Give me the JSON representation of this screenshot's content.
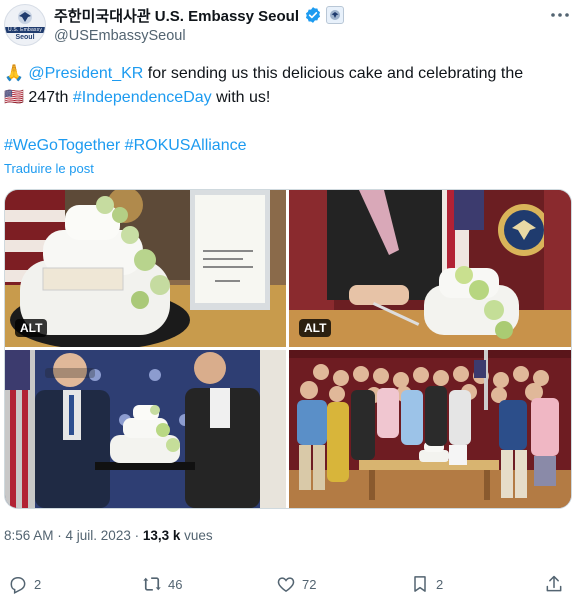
{
  "account": {
    "display_name": "주한미국대사관 U.S. Embassy Seoul",
    "handle": "@USEmbassySeoul",
    "avatar_text_top": "U.S. Embassy",
    "avatar_text_bottom": "Seoul"
  },
  "tweet": {
    "emoji_hands": "🙏",
    "mention": "@President_KR",
    "text_1": " for sending us this delicious cake and celebrating the",
    "emoji_flag": "🇺🇸",
    "text_2": " 247th ",
    "hashtag_day": "#IndependenceDay",
    "text_3": " with us!",
    "hashtag_1": "#WeGoTogether",
    "hashtag_2": "#ROKUSAlliance",
    "translate_label": "Traduire le post"
  },
  "media": {
    "alt_label": "ALT",
    "photos": [
      {
        "name": "cake-and-letter",
        "has_alt": true
      },
      {
        "name": "cake-cutting",
        "has_alt": true
      },
      {
        "name": "cake-handover",
        "has_alt": false
      },
      {
        "name": "group-photo",
        "has_alt": false
      }
    ]
  },
  "meta": {
    "time": "8:56 AM",
    "separator": " · ",
    "date": "4 juil. 2023",
    "views_count": "13,3 k",
    "views_label": " vues"
  },
  "actions": {
    "replies": "2",
    "reposts": "46",
    "likes": "72",
    "bookmarks": "2"
  },
  "colors": {
    "link": "#1d9bf0",
    "secondary_text": "#536471",
    "verified": "#1d9bf0"
  }
}
